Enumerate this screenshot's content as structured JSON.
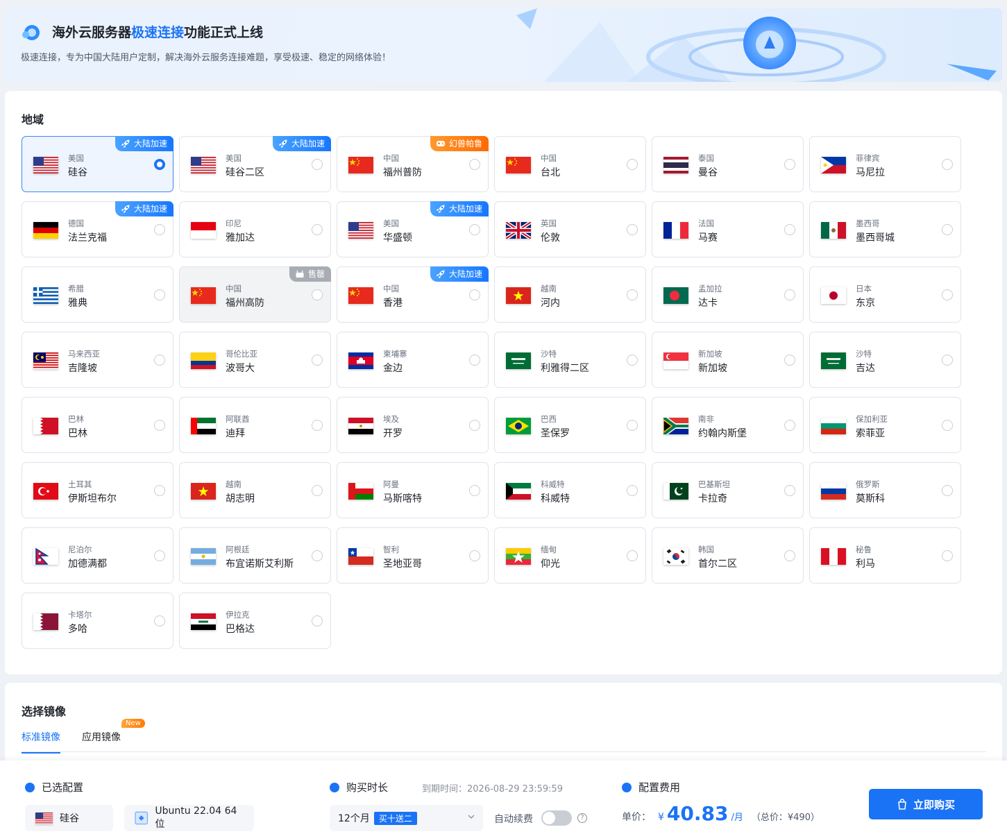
{
  "banner": {
    "title_pre": "海外云服务器",
    "title_hl": "极速连接",
    "title_post": "功能正式上线",
    "subtitle": "极速连接，专为中国大陆用户定制，解决海外云服务连接难题，享受极速、稳定的网络体验！"
  },
  "region": {
    "title": "地域",
    "tags": {
      "accel": "大陆加速",
      "game": "幻兽帕鲁",
      "soldout": "售罄"
    },
    "items": [
      {
        "country": "美国",
        "city": "硅谷",
        "flag": "us",
        "tag": "accel",
        "selected": true
      },
      {
        "country": "美国",
        "city": "硅谷二区",
        "flag": "us",
        "tag": "accel"
      },
      {
        "country": "中国",
        "city": "福州普防",
        "flag": "cn",
        "tag": "game"
      },
      {
        "country": "中国",
        "city": "台北",
        "flag": "cn"
      },
      {
        "country": "泰国",
        "city": "曼谷",
        "flag": "th"
      },
      {
        "country": "菲律宾",
        "city": "马尼拉",
        "flag": "ph"
      },
      {
        "country": "德国",
        "city": "法兰克福",
        "flag": "de",
        "tag": "accel"
      },
      {
        "country": "印尼",
        "city": "雅加达",
        "flag": "id"
      },
      {
        "country": "美国",
        "city": "华盛顿",
        "flag": "us",
        "tag": "accel"
      },
      {
        "country": "英国",
        "city": "伦敦",
        "flag": "gb"
      },
      {
        "country": "法国",
        "city": "马赛",
        "flag": "fr"
      },
      {
        "country": "墨西哥",
        "city": "墨西哥城",
        "flag": "mx"
      },
      {
        "country": "希腊",
        "city": "雅典",
        "flag": "gr"
      },
      {
        "country": "中国",
        "city": "福州高防",
        "flag": "cn",
        "tag": "soldout",
        "disabled": true
      },
      {
        "country": "中国",
        "city": "香港",
        "flag": "cn",
        "tag": "accel"
      },
      {
        "country": "越南",
        "city": "河内",
        "flag": "vn"
      },
      {
        "country": "孟加拉",
        "city": "达卡",
        "flag": "bd"
      },
      {
        "country": "日本",
        "city": "东京",
        "flag": "jp"
      },
      {
        "country": "马来西亚",
        "city": "吉隆坡",
        "flag": "my"
      },
      {
        "country": "哥伦比亚",
        "city": "波哥大",
        "flag": "co"
      },
      {
        "country": "柬埔寨",
        "city": "金边",
        "flag": "kh"
      },
      {
        "country": "沙特",
        "city": "利雅得二区",
        "flag": "sa"
      },
      {
        "country": "新加坡",
        "city": "新加坡",
        "flag": "sg"
      },
      {
        "country": "沙特",
        "city": "吉达",
        "flag": "sa"
      },
      {
        "country": "巴林",
        "city": "巴林",
        "flag": "bh"
      },
      {
        "country": "阿联酋",
        "city": "迪拜",
        "flag": "ae"
      },
      {
        "country": "埃及",
        "city": "开罗",
        "flag": "eg"
      },
      {
        "country": "巴西",
        "city": "圣保罗",
        "flag": "br"
      },
      {
        "country": "南非",
        "city": "约翰内斯堡",
        "flag": "za"
      },
      {
        "country": "保加利亚",
        "city": "索菲亚",
        "flag": "bg"
      },
      {
        "country": "土耳其",
        "city": "伊斯坦布尔",
        "flag": "tr"
      },
      {
        "country": "越南",
        "city": "胡志明",
        "flag": "vn"
      },
      {
        "country": "阿曼",
        "city": "马斯喀特",
        "flag": "om"
      },
      {
        "country": "科威特",
        "city": "科威特",
        "flag": "kw"
      },
      {
        "country": "巴基斯坦",
        "city": "卡拉奇",
        "flag": "pk"
      },
      {
        "country": "俄罗斯",
        "city": "莫斯科",
        "flag": "ru"
      },
      {
        "country": "尼泊尔",
        "city": "加德满都",
        "flag": "np"
      },
      {
        "country": "阿根廷",
        "city": "布宜诺斯艾利斯",
        "flag": "ar"
      },
      {
        "country": "智利",
        "city": "圣地亚哥",
        "flag": "cl"
      },
      {
        "country": "缅甸",
        "city": "仰光",
        "flag": "mm"
      },
      {
        "country": "韩国",
        "city": "首尔二区",
        "flag": "kr"
      },
      {
        "country": "秘鲁",
        "city": "利马",
        "flag": "pe"
      },
      {
        "country": "卡塔尔",
        "city": "多哈",
        "flag": "qa"
      },
      {
        "country": "伊拉克",
        "city": "巴格达",
        "flag": "iq"
      }
    ]
  },
  "image": {
    "title": "选择镜像",
    "tabs": [
      "标准镜像",
      "应用镜像"
    ],
    "new_badge": "New"
  },
  "bottom": {
    "selected_title": "已选配置",
    "selected_region": "硅谷",
    "selected_os": "Ubuntu 22.04 64位",
    "duration_title": "购买时长",
    "expire": "到期时间：2026-08-29 23:59:59",
    "duration_value": "12个月",
    "promo": "买十送二",
    "auto_renew": "自动续费",
    "fee_title": "配置费用",
    "price_label": "单价：",
    "currency": "¥",
    "price": "40.83",
    "unit": "/月",
    "total": "（总价：¥490）",
    "buy": "立即购买"
  },
  "colors": {
    "accent": "#1a73f5",
    "game": "#ff7a00",
    "soldout": "#a8acb3"
  }
}
